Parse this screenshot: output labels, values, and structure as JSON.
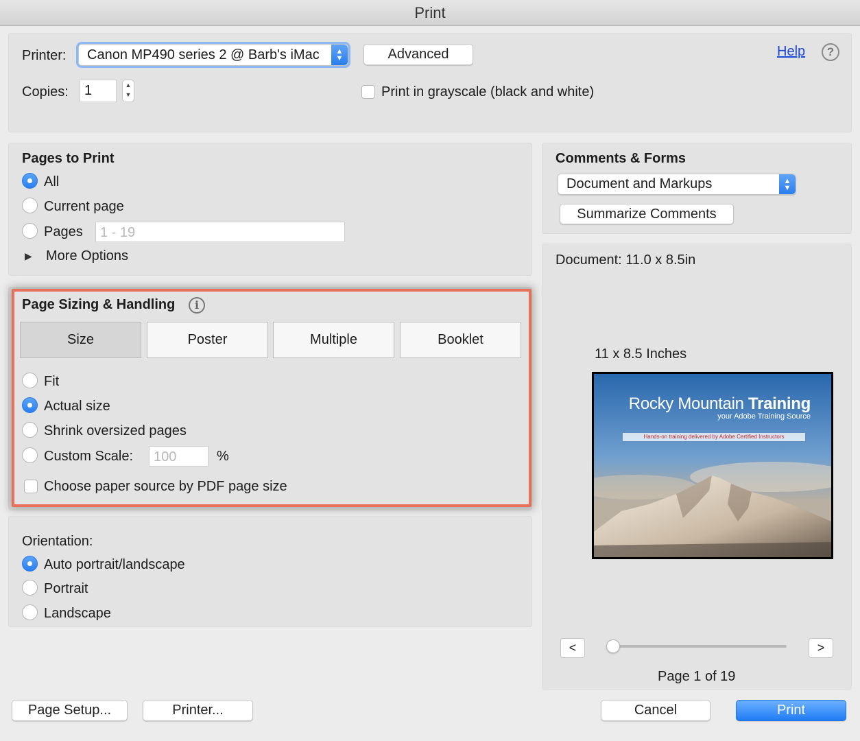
{
  "window": {
    "title": "Print"
  },
  "top": {
    "printer_label": "Printer:",
    "printer_value": "Canon MP490 series 2 @ Barb's iMac",
    "advanced_label": "Advanced",
    "help_label": "Help",
    "help_icon": "question-circle-icon",
    "copies_label": "Copies:",
    "copies_value": "1",
    "grayscale_label": "Print in grayscale (black and white)",
    "grayscale_checked": false
  },
  "pages_to_print": {
    "heading": "Pages to Print",
    "options": [
      {
        "label": "All",
        "selected": true
      },
      {
        "label": "Current page",
        "selected": false
      },
      {
        "label": "Pages",
        "selected": false
      }
    ],
    "pages_placeholder": "1 - 19",
    "more_options_label": "More Options"
  },
  "page_sizing": {
    "heading": "Page Sizing & Handling",
    "info_icon": "info-icon",
    "tabs": [
      {
        "label": "Size",
        "selected": true
      },
      {
        "label": "Poster",
        "selected": false
      },
      {
        "label": "Multiple",
        "selected": false
      },
      {
        "label": "Booklet",
        "selected": false
      }
    ],
    "options": [
      {
        "label": "Fit",
        "selected": false
      },
      {
        "label": "Actual size",
        "selected": true
      },
      {
        "label": "Shrink oversized pages",
        "selected": false
      },
      {
        "label": "Custom Scale:",
        "selected": false
      }
    ],
    "scale_placeholder": "100",
    "percent": "%",
    "paper_source_label": "Choose paper source by PDF page size",
    "highlight_color": "#e9715a"
  },
  "orientation": {
    "heading": "Orientation:",
    "options": [
      {
        "label": "Auto portrait/landscape",
        "selected": true
      },
      {
        "label": "Portrait",
        "selected": false
      },
      {
        "label": "Landscape",
        "selected": false
      }
    ]
  },
  "comments_forms": {
    "heading": "Comments & Forms",
    "select_value": "Document and Markups",
    "summarize_label": "Summarize Comments"
  },
  "preview": {
    "document_size": "Document: 11.0 x 8.5in",
    "paper_size": "11 x 8.5 Inches",
    "thumb_title_light": "Rocky Mountain ",
    "thumb_title_bold": "Training",
    "thumb_subtitle": "your Adobe Training Source",
    "thumb_band": "Hands-on training delivered by Adobe Certified Instructors",
    "prev_label": "<",
    "next_label": ">",
    "page_status": "Page 1 of 19"
  },
  "footer": {
    "page_setup_label": "Page Setup...",
    "printer_label": "Printer...",
    "cancel_label": "Cancel",
    "print_label": "Print"
  },
  "colors": {
    "accent": "#2a7ef0",
    "link": "#1c48d6"
  }
}
